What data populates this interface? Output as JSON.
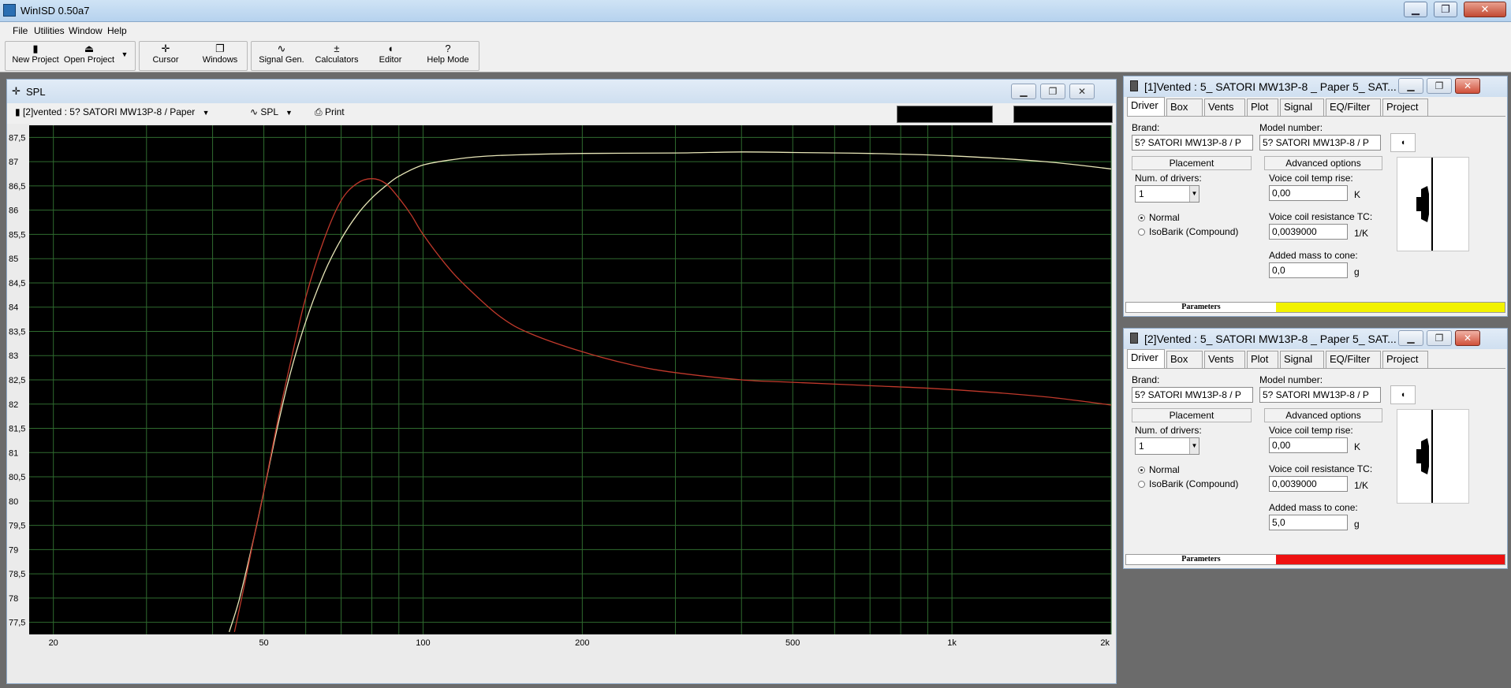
{
  "window": {
    "title": "WinISD 0.50a7",
    "minimize": "▁",
    "restore": "❐",
    "close": "✕"
  },
  "menu": [
    "File",
    "Utilities",
    "Window",
    "Help"
  ],
  "toolbar": {
    "new_project": "New Project",
    "open_project": "Open Project",
    "cursor": "Cursor",
    "windows": "Windows",
    "signal_gen": "Signal Gen.",
    "calculators": "Calculators",
    "editor": "Editor",
    "help_mode": "Help Mode"
  },
  "spl_window": {
    "title": "SPL",
    "project_select": "[2]vented : 5? SATORI MW13P-8 / Paper",
    "graph_select": "SPL",
    "print": "Print"
  },
  "chart_data": {
    "type": "line",
    "x_scale": "log",
    "xlim": [
      18,
      2000
    ],
    "ylim": [
      77.25,
      87.75
    ],
    "x_ticks": [
      20,
      50,
      100,
      200,
      500,
      1000,
      2000
    ],
    "x_tick_labels": [
      "20",
      "50",
      "100",
      "200",
      "500",
      "1k",
      "2k"
    ],
    "y_ticks": [
      77.5,
      78,
      78.5,
      79,
      79.5,
      80,
      80.5,
      81,
      81.5,
      82,
      82.5,
      83,
      83.5,
      84,
      84.5,
      85,
      85.5,
      86,
      86.5,
      87,
      87.5
    ],
    "y_tick_labels": [
      "77,5",
      "78",
      "78,5",
      "79",
      "79,5",
      "80",
      "80,5",
      "81",
      "81,5",
      "82",
      "82,5",
      "83",
      "83,5",
      "84",
      "84,5",
      "85",
      "85,5",
      "86",
      "86,5",
      "87",
      "87,5"
    ],
    "grid": true,
    "background": "#000000",
    "grid_color": "#2f6b2f",
    "series": [
      {
        "color": "#e8e6b8",
        "x": [
          43,
          45,
          48,
          50,
          53,
          56,
          60,
          65,
          70,
          75,
          80,
          85,
          90,
          100,
          115,
          130,
          150,
          200,
          300,
          400,
          500,
          700,
          1000,
          1500,
          2000
        ],
        "y": [
          77.3,
          78.0,
          79.3,
          80.2,
          81.5,
          82.6,
          83.7,
          84.7,
          85.4,
          85.9,
          86.25,
          86.5,
          86.7,
          86.93,
          87.05,
          87.11,
          87.14,
          87.17,
          87.18,
          87.2,
          87.19,
          87.17,
          87.12,
          87.0,
          86.85
        ]
      },
      {
        "color": "#c0392b",
        "x": [
          44,
          46,
          48,
          50,
          53,
          56,
          60,
          65,
          70,
          75,
          80,
          85,
          90,
          95,
          100,
          110,
          120,
          140,
          160,
          200,
          250,
          300,
          400,
          500,
          700,
          1000,
          1500,
          2000
        ],
        "y": [
          77.3,
          78.3,
          79.3,
          80.2,
          81.6,
          82.8,
          84.2,
          85.4,
          86.2,
          86.55,
          86.65,
          86.55,
          86.25,
          85.9,
          85.5,
          84.9,
          84.45,
          83.8,
          83.45,
          83.08,
          82.8,
          82.65,
          82.5,
          82.45,
          82.38,
          82.3,
          82.15,
          81.98
        ]
      }
    ]
  },
  "panels": [
    {
      "title": "[1]Vented : 5_ SATORI MW13P-8 _ Paper 5_ SAT...",
      "tabs": [
        "Driver",
        "Box",
        "Vents",
        "Plot",
        "Signal",
        "EQ/Filter",
        "Project"
      ],
      "brand_label": "Brand:",
      "brand": "5? SATORI MW13P-8 / P",
      "model_label": "Model number:",
      "model": "5? SATORI MW13P-8 / P",
      "placement": "Placement",
      "advanced": "Advanced options",
      "num_drivers_label": "Num. of drivers:",
      "num_drivers": "1",
      "vc_rise_label": "Voice coil temp rise:",
      "vc_rise": "0,00",
      "vc_rise_unit": "K",
      "vc_tc_label": "Voice coil resistance TC:",
      "vc_tc": "0,0039000",
      "vc_tc_unit": "1/K",
      "mass_label": "Added mass to cone:",
      "mass": "0,0",
      "mass_unit": "g",
      "normal": "Normal",
      "isobarik": "IsoBarik (Compound)",
      "parameters": "Parameters",
      "param_color": "#f2f200"
    },
    {
      "title": "[2]Vented : 5_ SATORI MW13P-8 _ Paper 5_ SAT...",
      "tabs": [
        "Driver",
        "Box",
        "Vents",
        "Plot",
        "Signal",
        "EQ/Filter",
        "Project"
      ],
      "brand_label": "Brand:",
      "brand": "5? SATORI MW13P-8 / P",
      "model_label": "Model number:",
      "model": "5? SATORI MW13P-8 / P",
      "placement": "Placement",
      "advanced": "Advanced options",
      "num_drivers_label": "Num. of drivers:",
      "num_drivers": "1",
      "vc_rise_label": "Voice coil temp rise:",
      "vc_rise": "0,00",
      "vc_rise_unit": "K",
      "vc_tc_label": "Voice coil resistance TC:",
      "vc_tc": "0,0039000",
      "vc_tc_unit": "1/K",
      "mass_label": "Added mass to cone:",
      "mass": "5,0",
      "mass_unit": "g",
      "normal": "Normal",
      "isobarik": "IsoBarik (Compound)",
      "parameters": "Parameters",
      "param_color": "#ee1111"
    }
  ]
}
